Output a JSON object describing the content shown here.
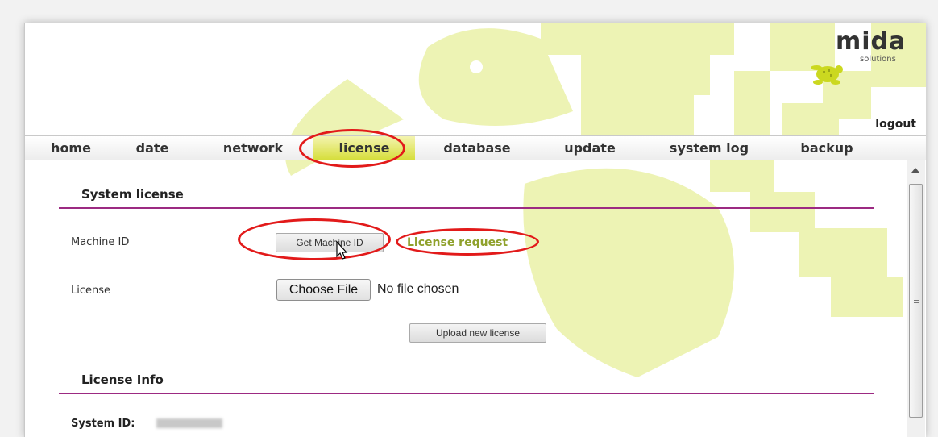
{
  "header": {
    "logo_word": "mida",
    "logo_sub": "solutions",
    "logout_label": "logout"
  },
  "nav": {
    "items": [
      {
        "label": "home"
      },
      {
        "label": "date"
      },
      {
        "label": "network"
      },
      {
        "label": "license",
        "active": true
      },
      {
        "label": "database"
      },
      {
        "label": "update"
      },
      {
        "label": "system log"
      },
      {
        "label": "backup"
      }
    ]
  },
  "system_license": {
    "title": "System license",
    "machine_id_label": "Machine ID",
    "get_machine_id_button": "Get Machine ID",
    "license_request_link": "License request",
    "license_label": "License",
    "choose_file_button": "Choose File",
    "file_status": "No file chosen",
    "upload_button": "Upload new license"
  },
  "license_info": {
    "title": "License Info",
    "system_id_label": "System ID:"
  },
  "colors": {
    "accent_rule": "#9c2a82",
    "nav_active": "#d6de3c",
    "watermark": "#e9f2a6",
    "annotation": "#e21a1a",
    "link": "#8fa12c"
  }
}
